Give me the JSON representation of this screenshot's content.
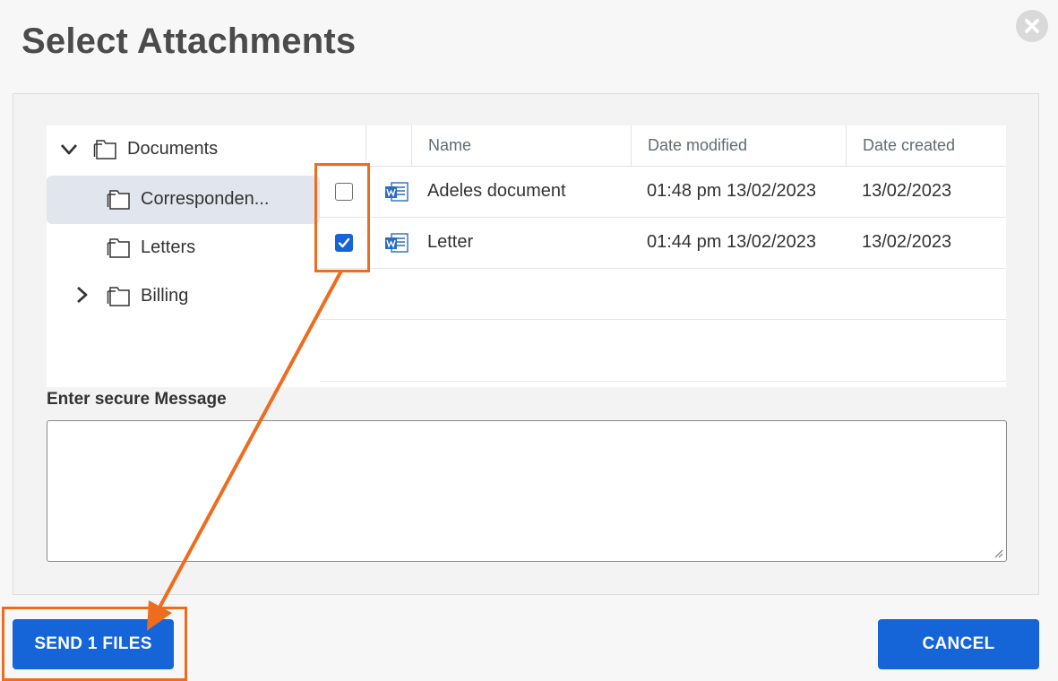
{
  "dialog": {
    "title": "Select Attachments"
  },
  "tree": {
    "items": [
      {
        "label": "Documents",
        "expanded": true,
        "level": 0,
        "selected": false
      },
      {
        "label": "Corresponden...",
        "expanded": false,
        "level": 1,
        "selected": true
      },
      {
        "label": "Letters",
        "expanded": false,
        "level": 1,
        "selected": false
      },
      {
        "label": "Billing",
        "expanded": false,
        "level": 1,
        "selected": false
      }
    ]
  },
  "grid": {
    "columns": [
      "Name",
      "Date modified",
      "Date created"
    ],
    "rows": [
      {
        "name": "Adeles document",
        "modified": "01:48 pm 13/02/2023",
        "created": "13/02/2023",
        "checked": false
      },
      {
        "name": "Letter",
        "modified": "01:44 pm 13/02/2023",
        "created": "13/02/2023",
        "checked": true
      }
    ]
  },
  "message": {
    "label": "Enter secure Message",
    "value": ""
  },
  "buttons": {
    "send_label": "SEND 1 FILES",
    "cancel_label": "CANCEL"
  },
  "colors": {
    "primary": "#1565d8",
    "highlight": "#ee6c1e",
    "selected_row": "#e1e5ed"
  }
}
